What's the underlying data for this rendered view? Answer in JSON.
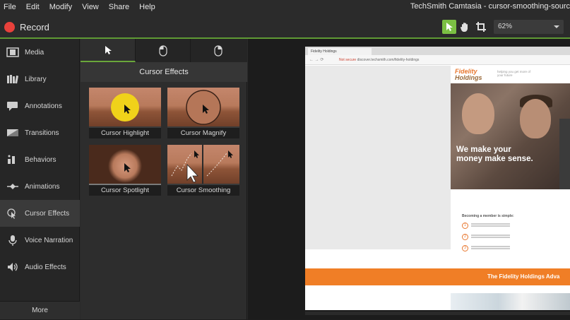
{
  "menu": [
    "File",
    "Edit",
    "Modify",
    "View",
    "Share",
    "Help"
  ],
  "window_title": "TechSmith Camtasia - cursor-smoothing-sourc",
  "toolbar": {
    "record_label": "Record",
    "tools": [
      "select-tool",
      "pan-tool",
      "crop-tool"
    ],
    "zoom": "62%"
  },
  "sidebar": {
    "items": [
      {
        "label": "Media",
        "icon": "film-icon"
      },
      {
        "label": "Library",
        "icon": "books-icon"
      },
      {
        "label": "Annotations",
        "icon": "callout-icon"
      },
      {
        "label": "Transitions",
        "icon": "transition-icon"
      },
      {
        "label": "Behaviors",
        "icon": "behavior-icon"
      },
      {
        "label": "Animations",
        "icon": "animation-icon"
      },
      {
        "label": "Cursor Effects",
        "icon": "cursor-icon"
      },
      {
        "label": "Voice Narration",
        "icon": "microphone-icon"
      },
      {
        "label": "Audio Effects",
        "icon": "speaker-icon"
      }
    ],
    "selected": "Cursor Effects",
    "more_label": "More"
  },
  "panel": {
    "header": "Cursor Effects",
    "subtabs": [
      "pointer-icon",
      "left-click-icon",
      "right-click-icon"
    ],
    "effects": [
      {
        "label": "Cursor Highlight"
      },
      {
        "label": "Cursor Magnify"
      },
      {
        "label": "Cursor Spotlight"
      },
      {
        "label": "Cursor Smoothing"
      }
    ]
  },
  "preview": {
    "tab_label": "Fidelity Holdings",
    "url_security": "Not secure",
    "url": "discover.techsmith.com/fidelity-holdings",
    "logo_line1": "Fidelity",
    "logo_line2": "Holdings",
    "tagline": "helping you get more of your future",
    "hero_line1": "We make your",
    "hero_line2": "money make sense.",
    "become_heading": "Becoming a member is simple:",
    "steps": [
      "1",
      "2",
      "3"
    ],
    "banner_text": "The Fidelity Holdings Adva"
  },
  "colors": {
    "accent_green": "#7bc043",
    "record_red": "#e8413b",
    "brand_orange": "#f07e26"
  }
}
